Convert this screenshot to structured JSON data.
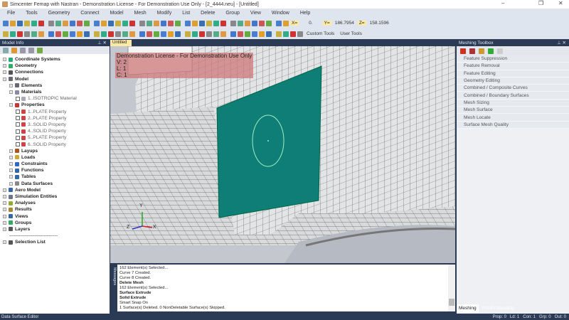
{
  "window": {
    "title": "Simcenter Femap with Nastran - Demonstration License - For Demonstration Use Only - [2_4444.neu] - [Untitled]",
    "min": "–",
    "max": "❐",
    "close": "✕"
  },
  "menu": [
    "File",
    "Tools",
    "Geometry",
    "Connect",
    "Model",
    "Mesh",
    "Modify",
    "List",
    "Delete",
    "Group",
    "View",
    "Window",
    "Help"
  ],
  "coords": {
    "x_label": "X=",
    "x": "0.",
    "y_label": "Y=",
    "y": "186.7954",
    "z_label": "Z=",
    "z": "158.1596"
  },
  "toolbar2": {
    "custom_tools": "Custom Tools",
    "user_tools": "User Tools"
  },
  "model_info": {
    "title": "Model Info",
    "pin": "⊥",
    "close": "✕",
    "tree": [
      {
        "label": "Coordinate Systems",
        "level": 0,
        "bold": true,
        "color": "#2a7"
      },
      {
        "label": "Geometry",
        "level": 0,
        "bold": true,
        "color": "#3a6"
      },
      {
        "label": "Connections",
        "level": 0,
        "bold": true,
        "color": "#555"
      },
      {
        "label": "Model",
        "level": 0,
        "bold": true,
        "color": "#667"
      },
      {
        "label": "Elements",
        "level": 1,
        "bold": true,
        "color": "#667"
      },
      {
        "label": "Materials",
        "level": 1,
        "bold": true,
        "color": "#88a"
      },
      {
        "label": "1..ISOTROPIC Material",
        "level": 2,
        "bold": false,
        "check": true,
        "color": "#aab"
      },
      {
        "label": "Properties",
        "level": 1,
        "bold": true,
        "color": "#c33"
      },
      {
        "label": "1..PLATE Property",
        "level": 2,
        "bold": false,
        "check": true,
        "color": "#c44"
      },
      {
        "label": "2..PLATE Property",
        "level": 2,
        "bold": false,
        "check": true,
        "color": "#c44"
      },
      {
        "label": "3..SOLID Property",
        "level": 2,
        "bold": false,
        "check": true,
        "color": "#c44"
      },
      {
        "label": "4..SOLID Property",
        "level": 2,
        "bold": false,
        "check": true,
        "color": "#c44"
      },
      {
        "label": "5..PLATE Property",
        "level": 2,
        "bold": false,
        "check": true,
        "color": "#c44"
      },
      {
        "label": "6..SOLID Property",
        "level": 2,
        "bold": false,
        "check": true,
        "color": "#c44"
      },
      {
        "label": "Layups",
        "level": 1,
        "bold": true,
        "color": "#a52"
      },
      {
        "label": "Loads",
        "level": 1,
        "bold": true,
        "color": "#ca3"
      },
      {
        "label": "Constraints",
        "level": 1,
        "bold": true,
        "color": "#36c"
      },
      {
        "label": "Functions",
        "level": 1,
        "bold": true,
        "color": "#36a"
      },
      {
        "label": "Tables",
        "level": 1,
        "bold": true,
        "color": "#36a"
      },
      {
        "label": "Data Surfaces",
        "level": 1,
        "bold": true,
        "color": "#888"
      },
      {
        "label": "Aero Model",
        "level": 0,
        "bold": true,
        "color": "#36a"
      },
      {
        "label": "Simulation Entities",
        "level": 0,
        "bold": true,
        "color": "#678"
      },
      {
        "label": "Analyses",
        "level": 0,
        "bold": true,
        "color": "#9a3"
      },
      {
        "label": "Results",
        "level": 0,
        "bold": true,
        "color": "#a83"
      },
      {
        "label": "Views",
        "level": 0,
        "bold": true,
        "color": "#36a"
      },
      {
        "label": "Groups",
        "level": 0,
        "bold": true,
        "color": "#3a6"
      },
      {
        "label": "Layers",
        "level": 0,
        "bold": true,
        "color": "#555"
      },
      {
        "label": "-------------------------------",
        "level": 1,
        "bold": false,
        "color": ""
      },
      {
        "label": "Selection List",
        "level": 0,
        "bold": true,
        "color": "#555"
      }
    ]
  },
  "viewport": {
    "tab": "Untitled",
    "tab_close": "✕",
    "demo_line": "Demonstration License - For Demonstration Use Only",
    "v": "V: 2",
    "l": "L: 1",
    "c": "C: 1",
    "axis_x": "X",
    "axis_y": "Y",
    "axis_z": "Z",
    "colors": {
      "surface": "#0e7e77",
      "curve": "#9ff0c0"
    }
  },
  "messages": {
    "side_label": "Messages",
    "lines": [
      {
        "text": "162 Element(s) Selected...",
        "bold": false
      },
      {
        "text": "Curve 7 Created.",
        "bold": false
      },
      {
        "text": "Curve 8 Created.",
        "bold": false
      },
      {
        "text": "Delete Mesh",
        "bold": true
      },
      {
        "text": "162 Element(s) Selected...",
        "bold": false
      },
      {
        "text": "Surface Extrude",
        "bold": true
      },
      {
        "text": "Solid Extrude",
        "bold": true
      },
      {
        "text": "Smart Snap On",
        "bold": false
      },
      {
        "text": "1 Surface(s) Deleted. 0 NonDeletable Surface(s) Skipped.",
        "bold": false
      }
    ]
  },
  "meshing_toolbox": {
    "title": "Meshing Toolbox",
    "pin": "⊥",
    "close": "✕",
    "items": [
      "Feature Suppression",
      "Feature Removal",
      "Feature Editing",
      "Geometry Editing",
      "Combined / Composite Curves",
      "Combined / Boundary Surfaces",
      "Mesh Sizing",
      "Mesh Surface",
      "Mesh Locate",
      "Surface Mesh Quality"
    ],
    "tabs": [
      "Meshing",
      "PostProcessing"
    ]
  },
  "status": {
    "left": "Data Surface Editor",
    "prop": "Prop: 0",
    "ld": "Ld: 1",
    "con": "Con: 1",
    "grp": "Grp: 0",
    "out": "Out: 0"
  }
}
